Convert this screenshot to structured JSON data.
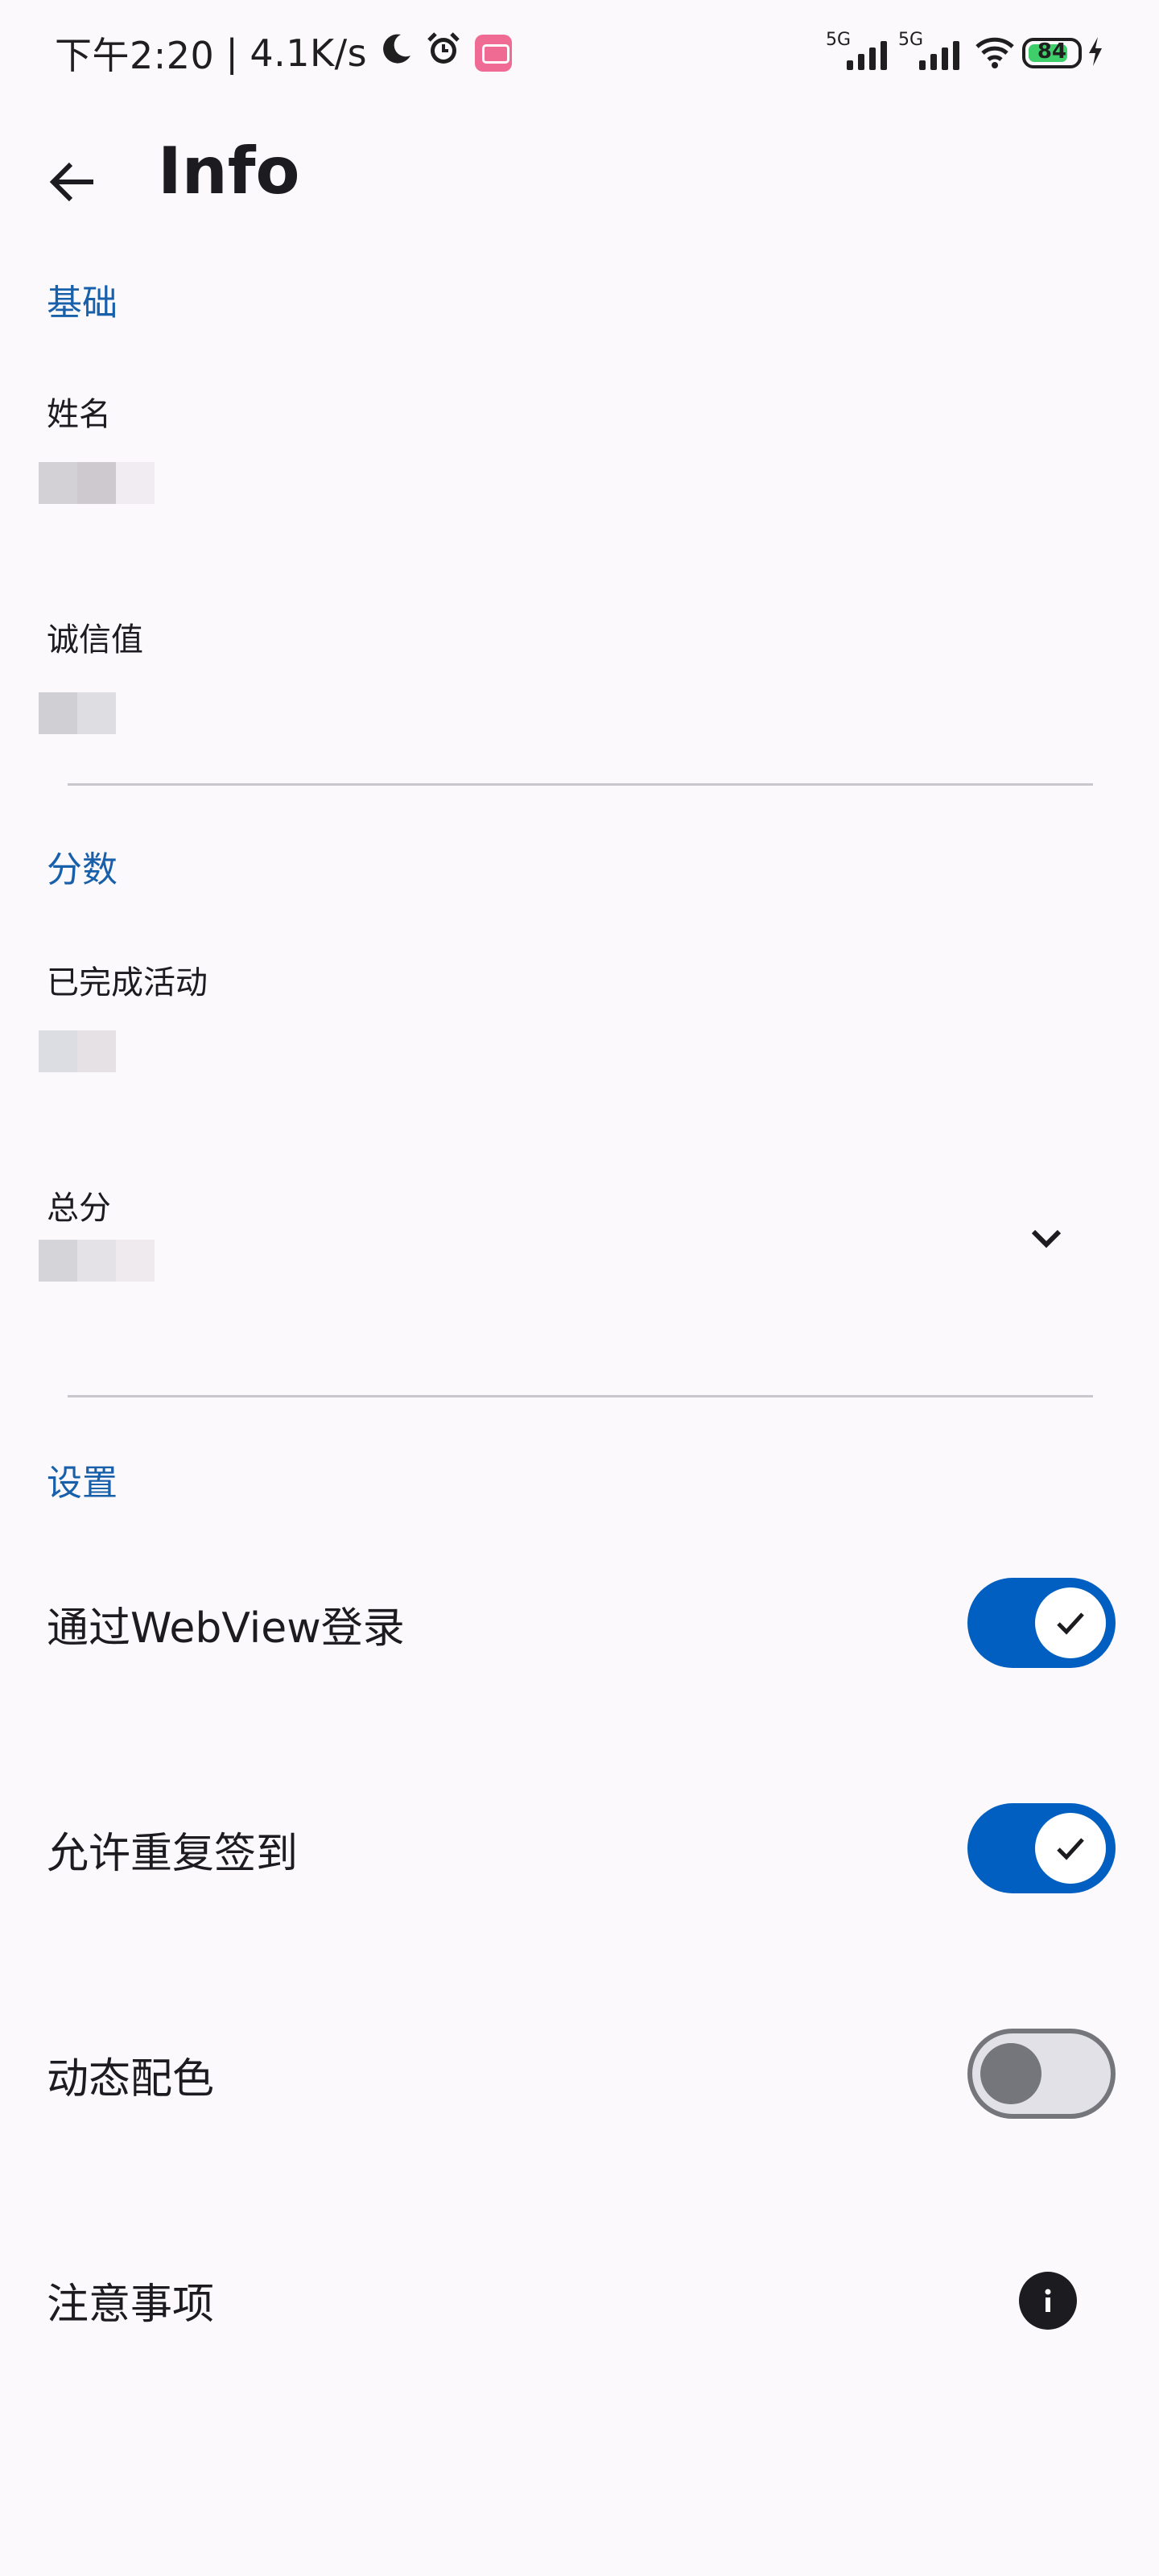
{
  "status_bar": {
    "time": "下午2:20",
    "separator": "|",
    "net_speed": "4.1K/s",
    "sim1_tag": "5G",
    "sim2_tag": "5G",
    "battery_level": "84",
    "icons": [
      "moon-icon",
      "alarm-icon",
      "bilibili-app-icon",
      "signal-icon",
      "wifi-icon",
      "battery-icon",
      "charging-icon"
    ]
  },
  "app_bar": {
    "title": "Info"
  },
  "sections": {
    "basic": {
      "header": "基础",
      "name_label": "姓名",
      "credit_label": "诚信值"
    },
    "score": {
      "header": "分数",
      "completed_label": "已完成活动",
      "total_label": "总分"
    },
    "settings": {
      "header": "设置",
      "webview_login": {
        "label": "通过WebView登录",
        "enabled": true
      },
      "repeat_checkin": {
        "label": "允许重复签到",
        "enabled": true
      },
      "dynamic_color": {
        "label": "动态配色",
        "enabled": false
      },
      "notes": {
        "label": "注意事项"
      }
    }
  },
  "colors": {
    "background": "#fcf9fc",
    "accent": "#005fc0",
    "section_header": "#1960aa",
    "switch_off_track": "#e2e1e8",
    "switch_off_thumb": "#74767c",
    "divider": "#c9c6cc"
  }
}
